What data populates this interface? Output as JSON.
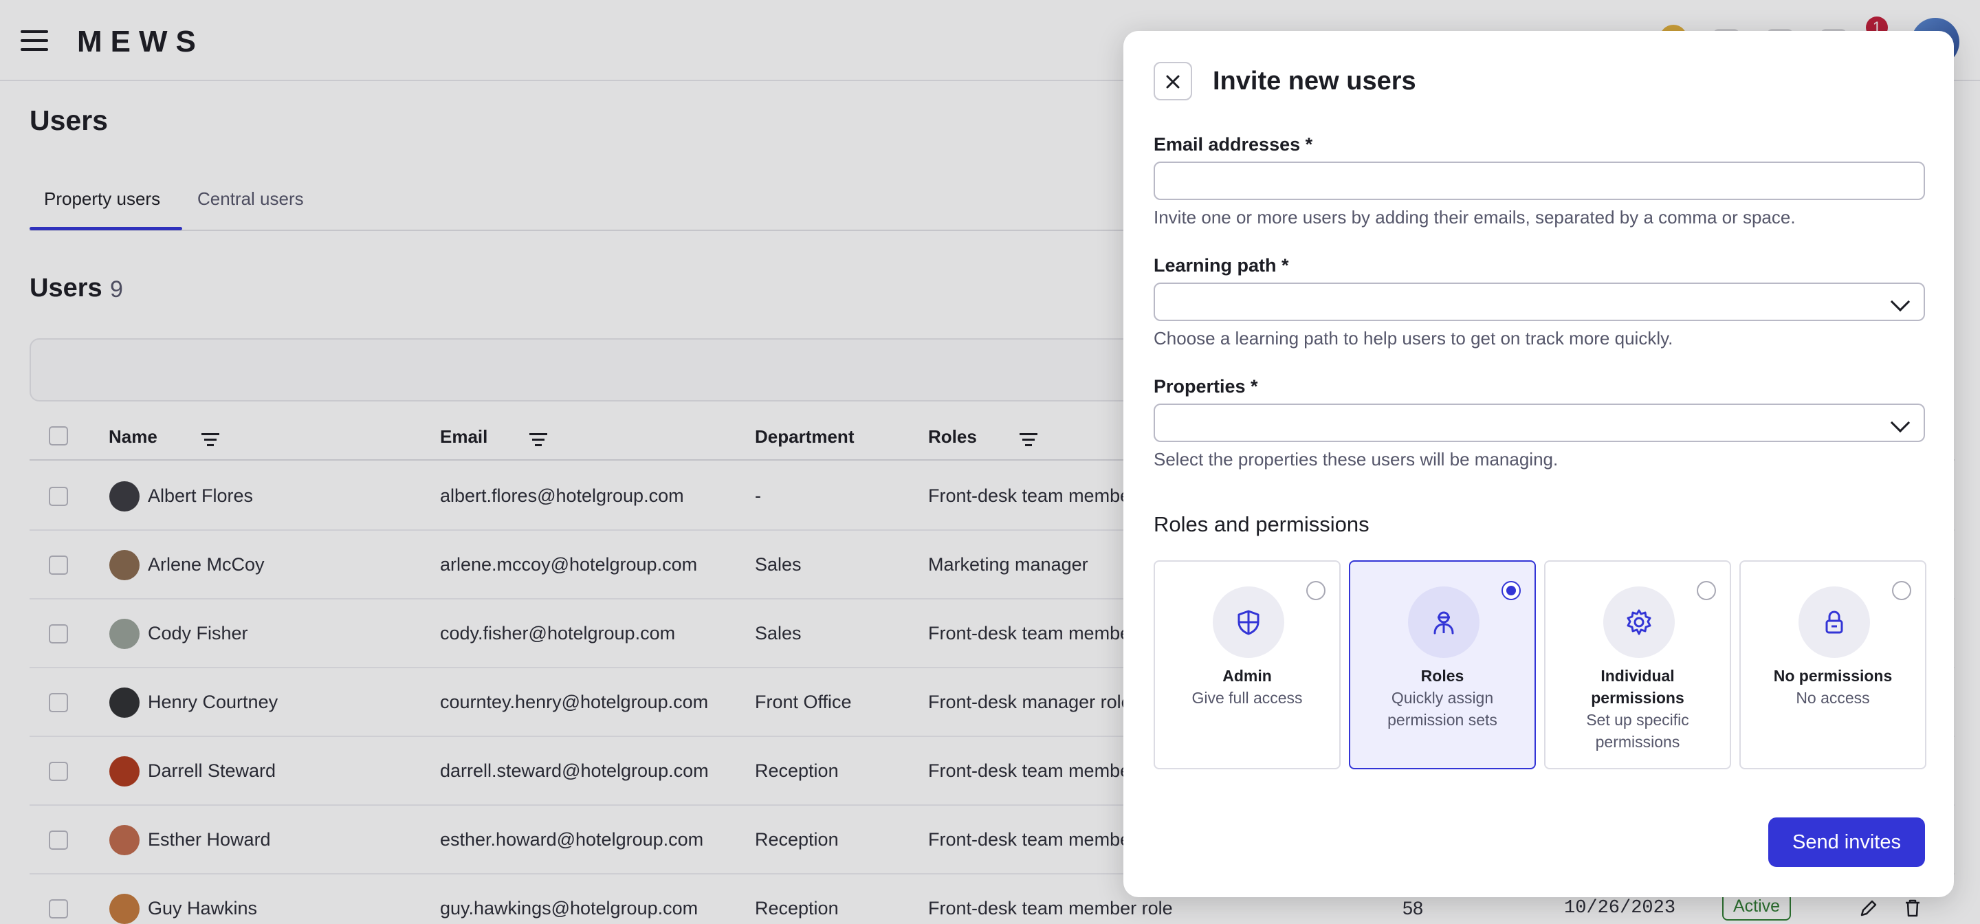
{
  "app": {
    "logo": "MEWS",
    "notification_count": "1"
  },
  "page": {
    "title": "Users"
  },
  "tabs": [
    {
      "label": "Property users"
    },
    {
      "label": "Central users"
    }
  ],
  "users_section": {
    "title": "Users",
    "count": "9"
  },
  "table": {
    "columns": {
      "name": "Name",
      "email": "Email",
      "department": "Department",
      "roles": "Roles"
    },
    "rows": [
      {
        "name": "Albert Flores",
        "email": "albert.flores@hotelgroup.com",
        "department": "-",
        "role": "Front-desk team member role",
        "avatar_color": "#3b3b40"
      },
      {
        "name": "Arlene McCoy",
        "email": "arlene.mccoy@hotelgroup.com",
        "department": "Sales",
        "role": "Marketing manager",
        "avatar_color": "#8a6b4e"
      },
      {
        "name": "Cody Fisher",
        "email": "cody.fisher@hotelgroup.com",
        "department": "Sales",
        "role": "Front-desk team member role",
        "avatar_color": "#9aa39a"
      },
      {
        "name": "Henry Courtney",
        "email": "courntey.henry@hotelgroup.com",
        "department": "Front Office",
        "role": "Front-desk manager role",
        "avatar_color": "#2f3033"
      },
      {
        "name": "Darrell Steward",
        "email": "darrell.steward@hotelgroup.com",
        "department": "Reception",
        "role": "Front-desk team member role",
        "avatar_color": "#b03a1c"
      },
      {
        "name": "Esther Howard",
        "email": "esther.howard@hotelgroup.com",
        "department": "Reception",
        "role": "Front-desk team member role",
        "avatar_color": "#c06a4c"
      },
      {
        "name": "Guy Hawkins",
        "email": "guy.hawkings@hotelgroup.com",
        "department": "Reception",
        "role": "Front-desk team member role",
        "avatar_color": "#c47a3c",
        "number": "58",
        "date": "10/26/2023",
        "status": "Active"
      }
    ]
  },
  "modal": {
    "title": "Invite new users",
    "email_label": "Email addresses *",
    "email_value": "",
    "email_help": "Invite one or more users by adding their emails, separated by a comma or space.",
    "learning_label": "Learning path *",
    "learning_value": "",
    "learning_help": "Choose a learning path to help users to get on track more quickly.",
    "properties_label": "Properties *",
    "properties_value": "",
    "properties_help": "Select the properties these users will be managing.",
    "roles_section": "Roles and permissions",
    "options": [
      {
        "title": "Admin",
        "description": "Give full access",
        "icon": "shield-icon",
        "selected": false
      },
      {
        "title": "Roles",
        "description": "Quickly assign permission sets",
        "icon": "person-icon",
        "selected": true
      },
      {
        "title": "Individual permissions",
        "description": "Set up specific permissions",
        "icon": "gear-icon",
        "selected": false
      },
      {
        "title": "No permissions",
        "description": "No access",
        "icon": "lock-icon",
        "selected": false
      }
    ],
    "send_label": "Send invites"
  },
  "colors": {
    "accent": "#3335d6",
    "active_status": "#2e7d32",
    "notification": "#c41e3a"
  }
}
